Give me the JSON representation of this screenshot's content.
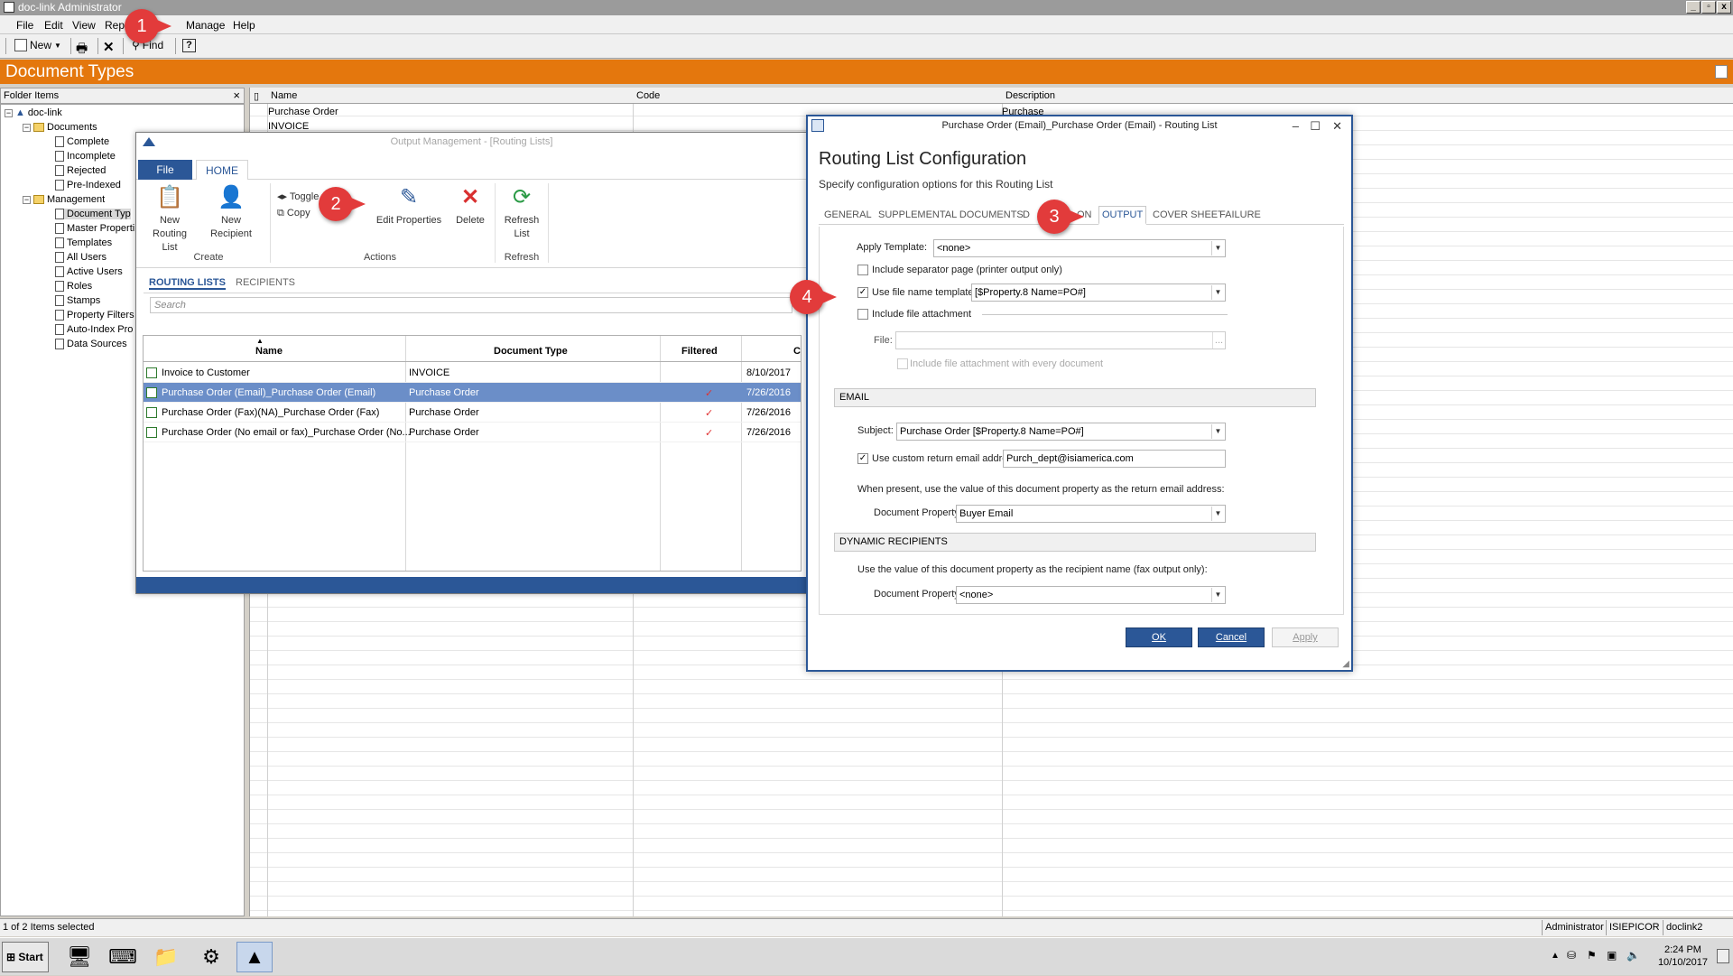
{
  "app": {
    "title": "doc-link Administrator",
    "window_buttons": [
      "_",
      "▫",
      "x"
    ]
  },
  "menu": [
    "File",
    "Edit",
    "View",
    "Rep",
    "Manage",
    "Help"
  ],
  "toolbar": {
    "new_label": "New",
    "find_label": "Find"
  },
  "page_title": "Document Types",
  "folder_pane": {
    "title": "Folder Items",
    "close": "×",
    "nodes": [
      "doc-link",
      "Documents",
      "Complete",
      "Incomplete",
      "Rejected",
      "Pre-Indexed",
      "Management",
      "Document Typ",
      "Master Properti",
      "Templates",
      "All Users",
      "Active Users",
      "Roles",
      "Stamps",
      "Property Filters",
      "Auto-Index Pro",
      "Data Sources"
    ]
  },
  "grid": {
    "columns": [
      "Name",
      "Code",
      "Description"
    ],
    "rows": [
      [
        "Purchase Order",
        "",
        "Purchase Order"
      ],
      [
        "INVOICE",
        "",
        ""
      ]
    ]
  },
  "status": {
    "selection": "1 of 2 Items selected",
    "user": "Administrator",
    "server": "ISIEPICOR",
    "db": "doclink2"
  },
  "taskbar": {
    "start": "Start",
    "time": "2:24 PM",
    "date": "10/10/2017"
  },
  "output_window": {
    "title": "Output Management - [Routing Lists]",
    "file_tab": "File",
    "home_tab": "HOME",
    "ribbon": {
      "new_routing_list": [
        "New",
        "Routing List"
      ],
      "new_recipient": [
        "New",
        "Recipient"
      ],
      "toggle": "Toggle",
      "copy": "Copy",
      "edit_properties": "Edit Properties",
      "delete": "Delete",
      "refresh_list": [
        "Refresh",
        "List"
      ],
      "groups": [
        "Create",
        "Actions",
        "Refresh"
      ]
    },
    "subtabs": [
      "ROUTING LISTS",
      "RECIPIENTS"
    ],
    "search_placeholder": "Search",
    "columns": [
      "Name",
      "Document Type",
      "Filtered",
      "C"
    ],
    "rows": [
      {
        "name": "Invoice to Customer",
        "doc_type": "INVOICE",
        "filtered": "",
        "date": "8/10/2017"
      },
      {
        "name": "Purchase Order (Email)_Purchase Order (Email)",
        "doc_type": "Purchase Order",
        "filtered": "✓",
        "date": "7/26/2016"
      },
      {
        "name": "Purchase Order (Fax)(NA)_Purchase Order (Fax)",
        "doc_type": "Purchase Order",
        "filtered": "✓",
        "date": "7/26/2016"
      },
      {
        "name": "Purchase Order (No email or fax)_Purchase Order (No...",
        "doc_type": "Purchase Order",
        "filtered": "✓",
        "date": "7/26/2016"
      }
    ]
  },
  "dialog": {
    "title": "Purchase Order (Email)_Purchase Order (Email) - Routing List",
    "heading": "Routing List Configuration",
    "subheading": "Specify configuration options for this Routing List",
    "tabs": [
      "GENERAL",
      "SUPPLEMENTAL DOCUMENTS",
      "D",
      "ON",
      "OUTPUT",
      "COVER SHEET",
      "FAILURE"
    ],
    "apply_template_label": "Apply Template:",
    "apply_template_value": "<none>",
    "include_separator_label": "Include separator page  (printer output only)",
    "use_file_name_label": "Use file name template:",
    "use_file_name_value": "[$Property.8 Name=PO#]",
    "include_attachment_label": "Include file attachment",
    "file_label": "File:",
    "file_browse": "...",
    "include_every_label": "Include file attachment with every document",
    "email_section": "EMAIL",
    "subject_label": "Subject:",
    "subject_value": "Purchase Order [$Property.8 Name=PO#]",
    "custom_return_label": "Use custom return email address:",
    "custom_return_value": "Purch_dept@isiamerica.com",
    "when_present_text": "When present, use the value of this document property as the return email address:",
    "doc_property_label": "Document Property:",
    "doc_property_value": "Buyer Email",
    "dynamic_section": "DYNAMIC RECIPIENTS",
    "dynamic_text": "Use the value of this document property as the recipient name (fax output only):",
    "doc_property2_label": "Document Property:",
    "doc_property2_value": "<none>",
    "ok": "OK",
    "cancel": "Cancel",
    "apply": "Apply"
  },
  "callouts": [
    "1",
    "2",
    "3",
    "4"
  ],
  "colors": {
    "accent": "#2b5797",
    "orange": "#e4770d",
    "callout": "#e23b3b",
    "selection": "#6b8ec8"
  }
}
